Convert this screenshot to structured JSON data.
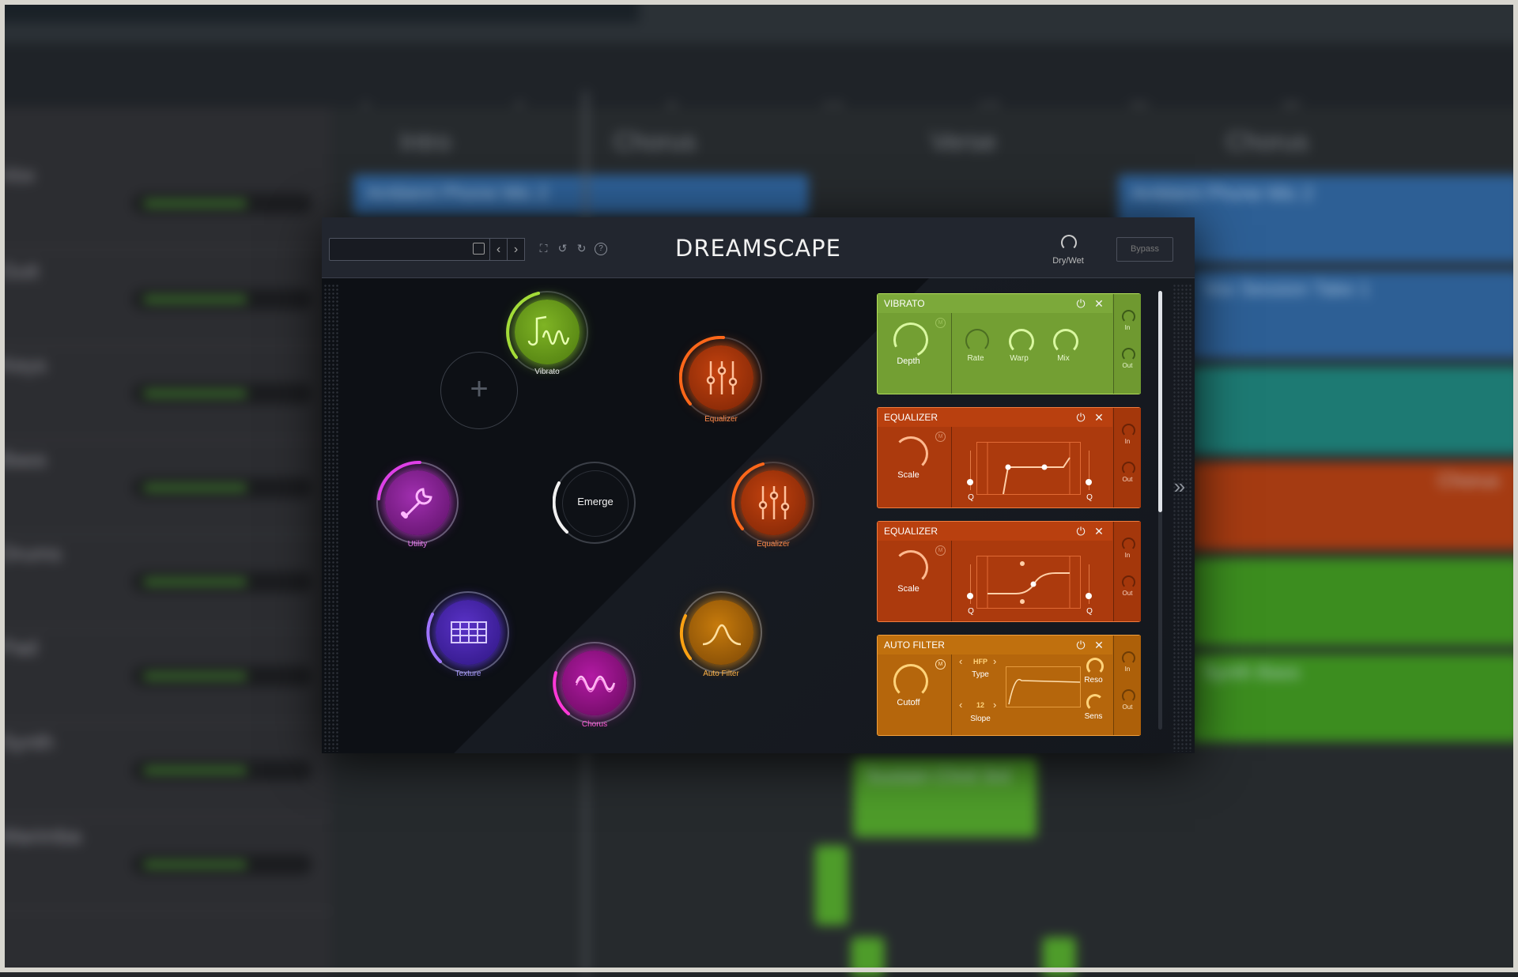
{
  "daw": {
    "markers": [
      "1",
      "5",
      "9",
      "13",
      "17",
      "21",
      "25"
    ],
    "sections": [
      "Intro",
      "Chorus",
      "Verse",
      "Chorus"
    ],
    "clips": [
      "Ambient Phone Mic 2",
      "Ambient Phone Mic 2",
      "Vox Session Take 1",
      "Chorus",
      "Synth Bass",
      "Sustain Chrd 3rd"
    ],
    "tracks": [
      "Vox",
      "Guit",
      "Keys",
      "Bass",
      "Drums",
      "Pad",
      "Synth",
      "Marimba"
    ]
  },
  "plugin": {
    "title": "DREAMSCAPE",
    "preset_name": "",
    "drywet_label": "Dry/Wet",
    "bypass_label": "Bypass",
    "icons": [
      "save-icon",
      "prev-icon",
      "next-icon",
      "fullscreen-icon",
      "undo-icon",
      "redo-icon",
      "help-icon"
    ],
    "center_node": "Emerge",
    "nodes": [
      {
        "label": "Vibrato",
        "color": "#a8e03a",
        "active": true
      },
      {
        "label": "Equalizer",
        "color": "#ff6a1c",
        "active": true
      },
      {
        "label": "Equalizer",
        "color": "#ff6a1c",
        "active": true
      },
      {
        "label": "Auto Filter",
        "color": "#ffa514",
        "active": true
      },
      {
        "label": "Chorus",
        "color": "#ff3ad8",
        "active": true
      },
      {
        "label": "Texture",
        "color": "#7a3cff",
        "active": true
      },
      {
        "label": "Utility",
        "color": "#e040e8",
        "active": true
      }
    ],
    "modules": {
      "vibrato": {
        "title": "VIBRATO",
        "big": "Depth",
        "knobs": [
          "Rate",
          "Warp",
          "Mix"
        ],
        "in": "In",
        "out": "Out",
        "badge": "M"
      },
      "eq1": {
        "title": "EQUALIZER",
        "big": "Scale",
        "q_left": "Q",
        "q_right": "Q",
        "in": "In",
        "out": "Out",
        "badge": "M"
      },
      "eq2": {
        "title": "EQUALIZER",
        "big": "Scale",
        "q_left": "Q",
        "q_right": "Q",
        "in": "In",
        "out": "Out",
        "badge": "M"
      },
      "autofilter": {
        "title": "AUTO FILTER",
        "big": "Cutoff",
        "type_label": "Type",
        "type_value": "HFP",
        "slope_label": "Slope",
        "slope_value": "12",
        "reso": "Reso",
        "sens": "Sens",
        "in": "In",
        "out": "Out",
        "badge": "M"
      }
    }
  },
  "colors": {
    "vibrato": "#7cac3a",
    "equalizer": "#b9400f",
    "autofilter": "#c0700e"
  }
}
